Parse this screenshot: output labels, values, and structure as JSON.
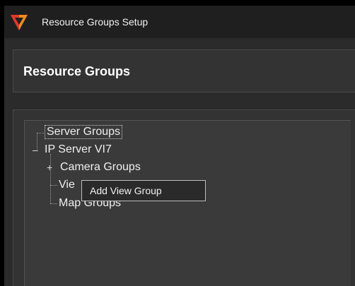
{
  "window": {
    "title": "Resource Groups Setup",
    "app_icon": "app-logo-icon"
  },
  "header": {
    "title": "Resource Groups"
  },
  "tree": {
    "root": "Server Groups",
    "server": {
      "label": "IP Server VI7",
      "expander": "–"
    },
    "children": [
      {
        "label": "Camera Groups",
        "expander": "+"
      },
      {
        "label": "Vie"
      },
      {
        "label": "Map Groups"
      }
    ]
  },
  "context_menu": {
    "items": [
      {
        "label": "Add View Group"
      }
    ]
  },
  "colors": {
    "window_bg": "#2b2b2b",
    "panel_bg": "#333333",
    "logo_orange": "#f08a1c",
    "logo_red": "#e2382a"
  }
}
